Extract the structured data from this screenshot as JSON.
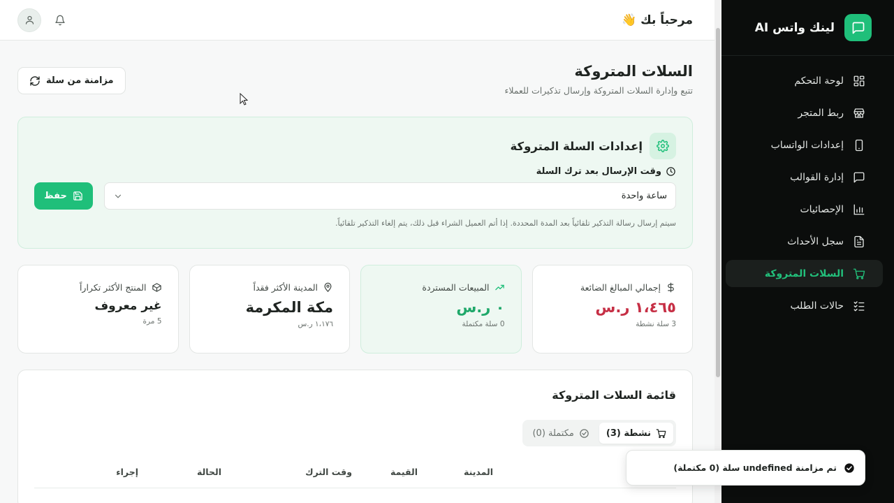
{
  "brand": {
    "name": "لينك واتس AI"
  },
  "nav": [
    {
      "label": "لوحة التحكم",
      "icon": "dashboard-icon"
    },
    {
      "label": "ربط المتجر",
      "icon": "store-icon"
    },
    {
      "label": "إعدادات الواتساب",
      "icon": "phone-icon"
    },
    {
      "label": "إدارة القوالب",
      "icon": "message-icon"
    },
    {
      "label": "الإحصائيات",
      "icon": "bar-chart-icon"
    },
    {
      "label": "سجل الأحداث",
      "icon": "file-text-icon"
    },
    {
      "label": "السلات المتروكة",
      "icon": "cart-icon",
      "active": true
    },
    {
      "label": "حالات الطلب",
      "icon": "list-checks-icon"
    }
  ],
  "topbar": {
    "welcome": "مرحباً بك 👋"
  },
  "page": {
    "title": "السلات المتروكة",
    "subtitle": "تتبع وإدارة السلات المتروكة وإرسال تذكيرات للعملاء",
    "sync_label": "مزامنة من سلة"
  },
  "settings": {
    "title": "إعدادات السلة المتروكة",
    "field_label": "وقت الإرسال بعد ترك السلة",
    "selected_value": "ساعة واحدة",
    "save_label": "حفظ",
    "hint": "سيتم إرسال رسالة التذكير تلقائياً بعد المدة المحددة. إذا أتم العميل الشراء قبل ذلك، يتم إلغاء التذكير تلقائياً."
  },
  "stats": {
    "lost": {
      "label": "إجمالي المبالغ الضائعة",
      "value": "١،٤٦٥ ر.س",
      "sub": "3 سلة نشطة"
    },
    "recovered": {
      "label": "المبيعات المستردة",
      "value": "٠ ر.س",
      "sub": "0 سلة مكتملة"
    },
    "city": {
      "label": "المدينة الأكثر فقداً",
      "value": "مكة المكرمة",
      "sub": "١،١٧٦ ر.س"
    },
    "product": {
      "label": "المنتج الأكثر تكراراً",
      "value": "غير معروف",
      "sub": "5 مرة"
    }
  },
  "list": {
    "title": "قائمة السلات المتروكة",
    "tab_active": "نشطة (3)",
    "tab_completed": "مكتملة (0)",
    "columns": [
      "المدينة",
      "القيمة",
      "وقت الترك",
      "الحالة",
      "إجراء"
    ]
  },
  "toast": {
    "message": "تم مزامنة undefined سلة (0 مكتملة)"
  },
  "colors": {
    "accent": "#1fbf7a",
    "danger": "#c62f45",
    "sidebar_bg": "#0b0d0c"
  }
}
